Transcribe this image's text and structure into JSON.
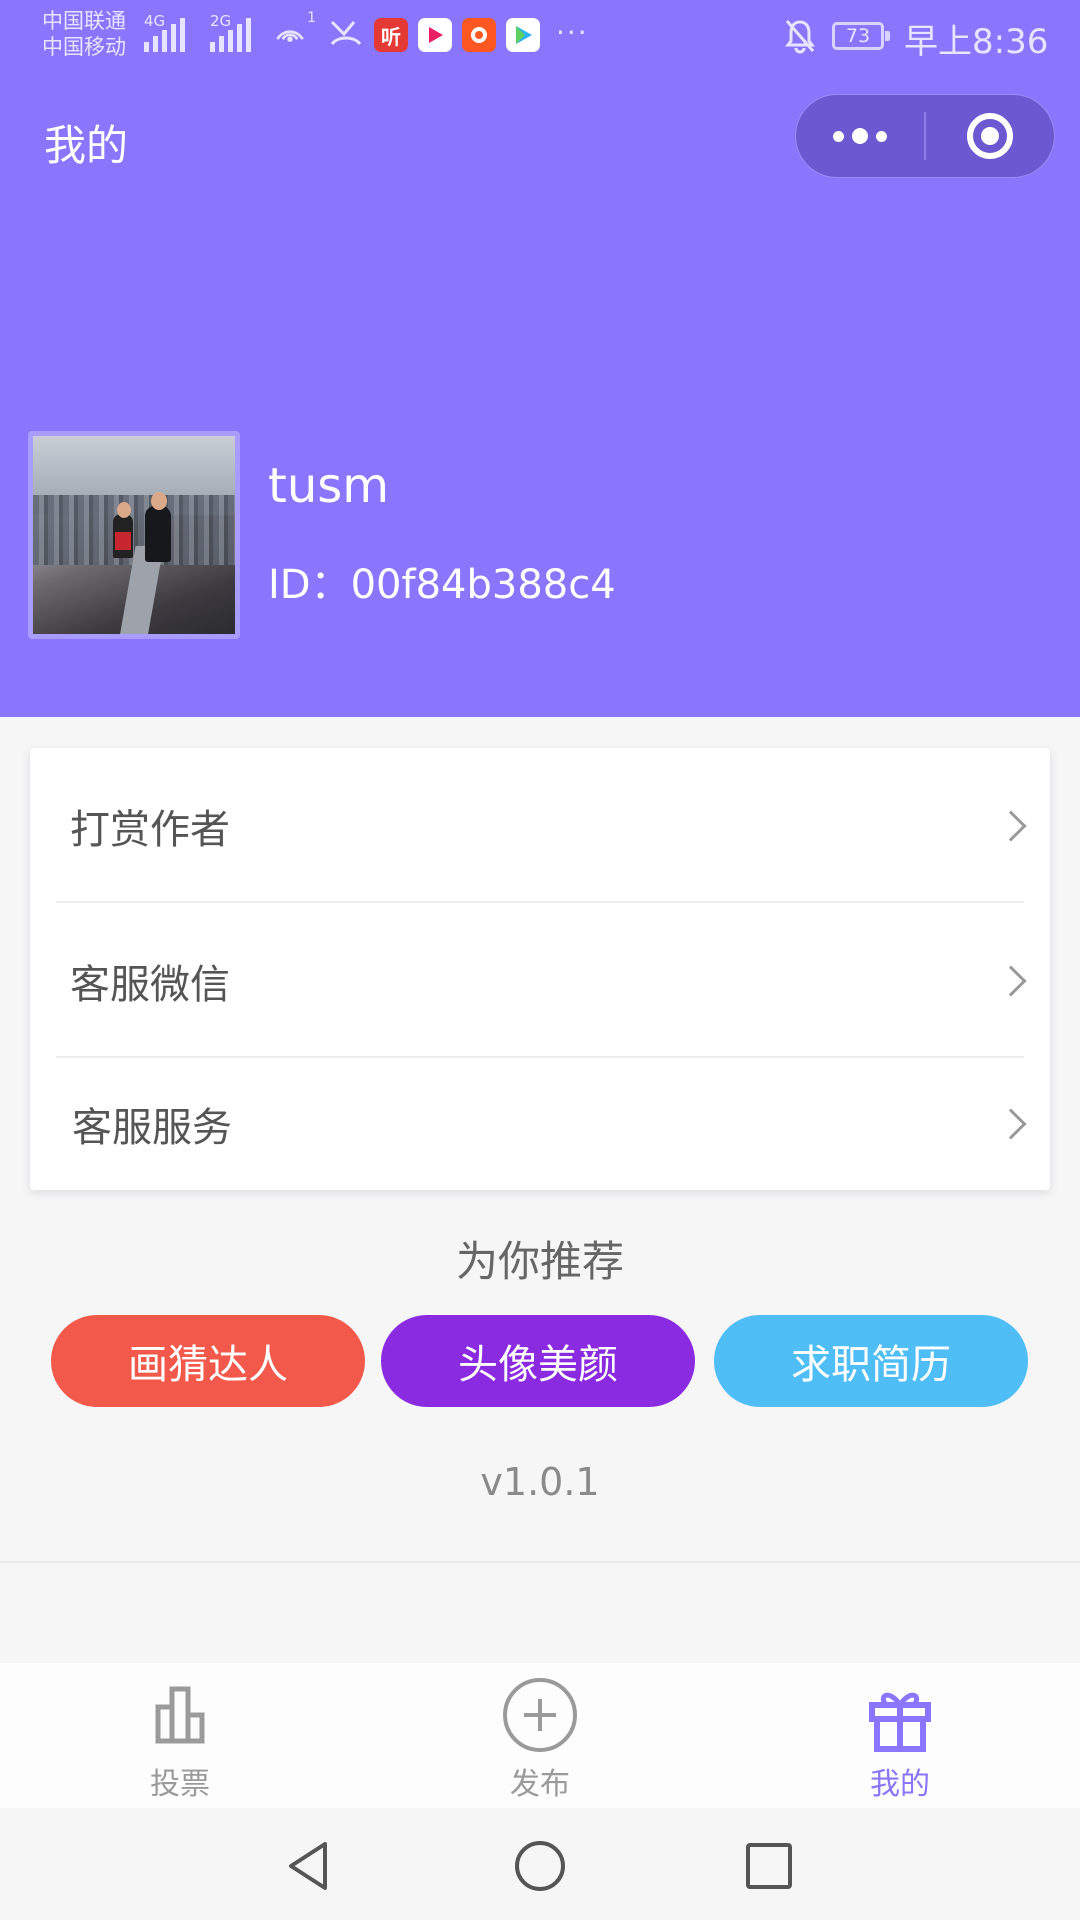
{
  "status_bar": {
    "carrier_1": "中国联通",
    "carrier_2": "中国移动",
    "network_1": "4G",
    "network_2": "2G",
    "hotspot_count": "1",
    "more": "···",
    "battery": "73",
    "time": "早上8:36"
  },
  "header": {
    "title": "我的",
    "capsule": {
      "more_icon": "more-dots-icon",
      "close_icon": "target-circle-icon"
    },
    "background_color": "#8a76fc"
  },
  "profile": {
    "username": "tusm",
    "user_id": "ID：00f84b388c4"
  },
  "menu": {
    "items": [
      {
        "label": "打赏作者"
      },
      {
        "label": "客服微信"
      },
      {
        "label": "客服服务"
      }
    ]
  },
  "recommend": {
    "title": "为你推荐",
    "apps": [
      {
        "label": "画猜达人",
        "color": "#f2594b"
      },
      {
        "label": "头像美颜",
        "color": "#8a2be2"
      },
      {
        "label": "求职简历",
        "color": "#4fbdf6"
      }
    ]
  },
  "version": "v1.0.1",
  "tabbar": {
    "active_color": "#8a76fc",
    "inactive_color": "#9a9a9a",
    "tabs": [
      {
        "label": "投票",
        "icon": "bar-chart-icon",
        "active": false
      },
      {
        "label": "发布",
        "icon": "plus-circle-icon",
        "active": false
      },
      {
        "label": "我的",
        "icon": "gift-icon",
        "active": true
      }
    ]
  },
  "android_nav": {
    "back": "back-triangle-icon",
    "home": "home-circle-icon",
    "recents": "recents-square-icon"
  }
}
